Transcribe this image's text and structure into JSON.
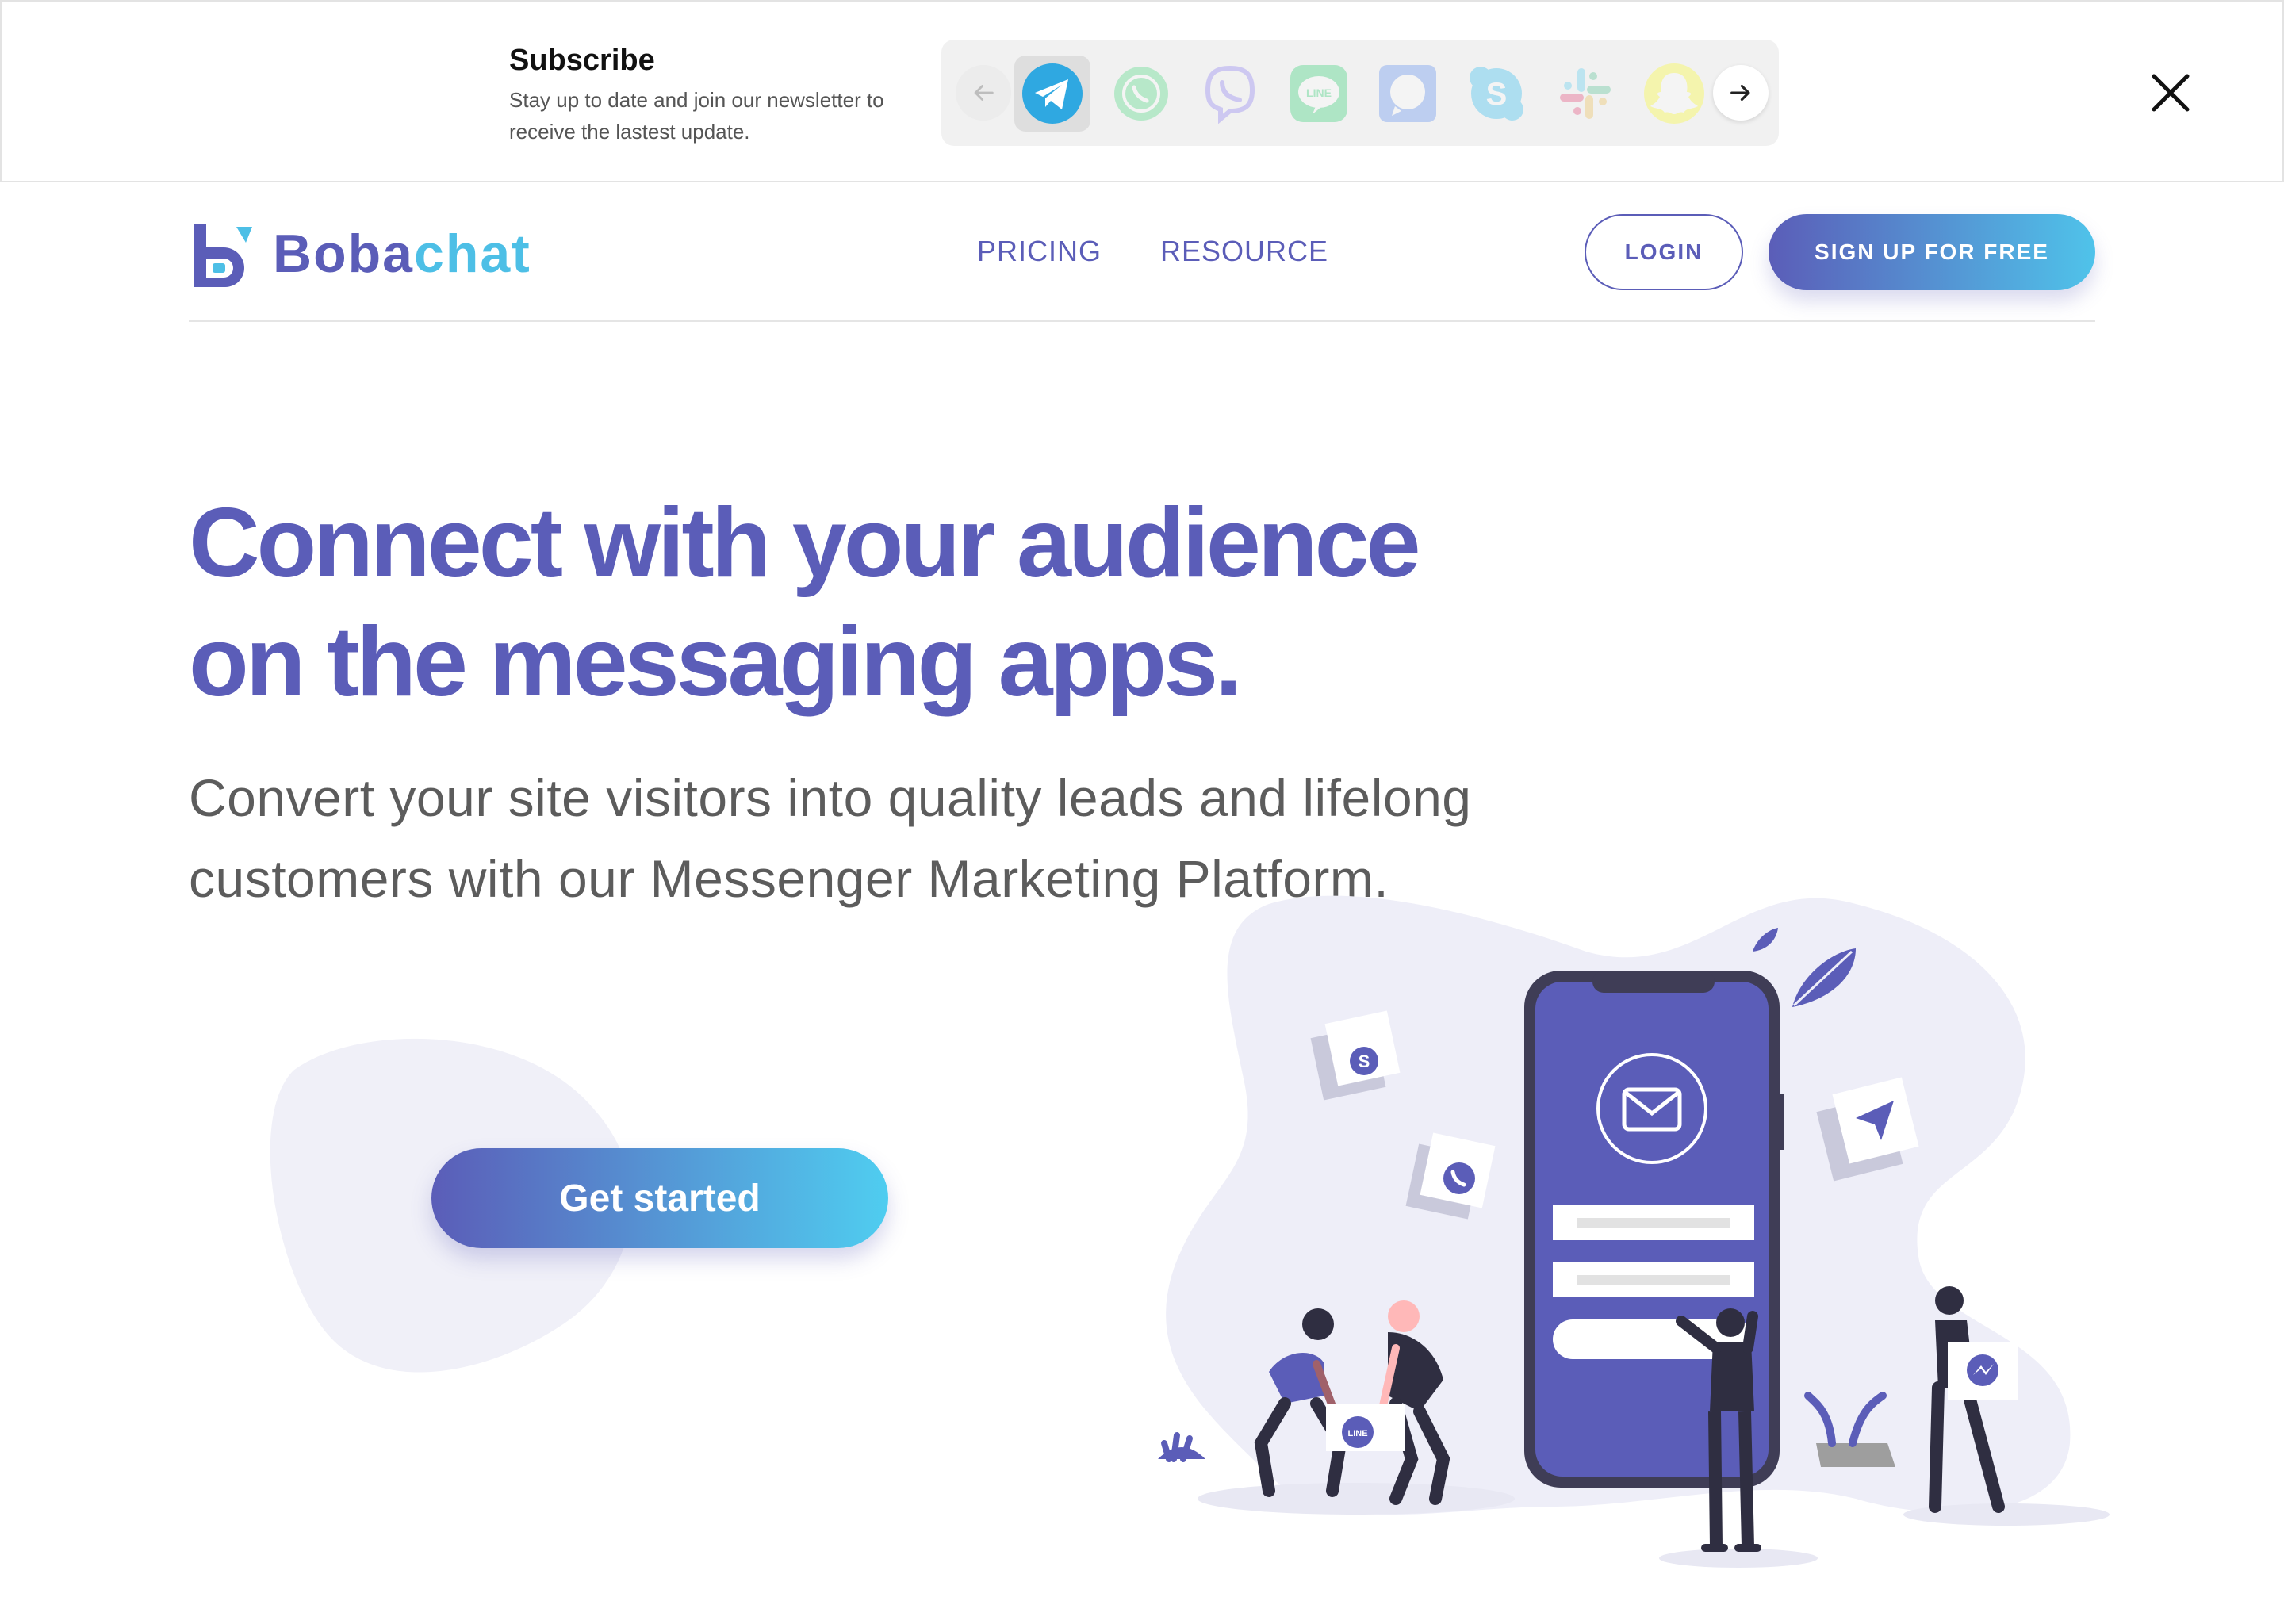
{
  "subscribe": {
    "title": "Subscribe",
    "description": "Stay up to date and join our newsletter to receive the lastest update.",
    "apps": [
      "telegram",
      "whatsapp",
      "viber",
      "line",
      "signal",
      "skype",
      "slack",
      "snapchat"
    ],
    "active_app": "telegram"
  },
  "header": {
    "logo_part1": "Boba",
    "logo_part2": "chat",
    "nav": [
      "PRICING",
      "RESOURCE"
    ],
    "login_label": "LOGIN",
    "signup_label": "SIGN UP FOR FREE"
  },
  "hero": {
    "title_line1": "Connect with your audience",
    "title_line2": "on the messaging apps.",
    "subtitle_line1": "Convert your site visitors into quality leads and lifelong",
    "subtitle_line2": "customers with our Messenger Marketing Platform.",
    "cta_label": "Get started"
  },
  "illustration": {
    "line_badge": "LINE"
  },
  "colors": {
    "brand_purple": "#5b5db8",
    "brand_cyan": "#4dbfe6",
    "text_gray": "#5c5c5c",
    "blob_lavender": "#eeeef8"
  }
}
